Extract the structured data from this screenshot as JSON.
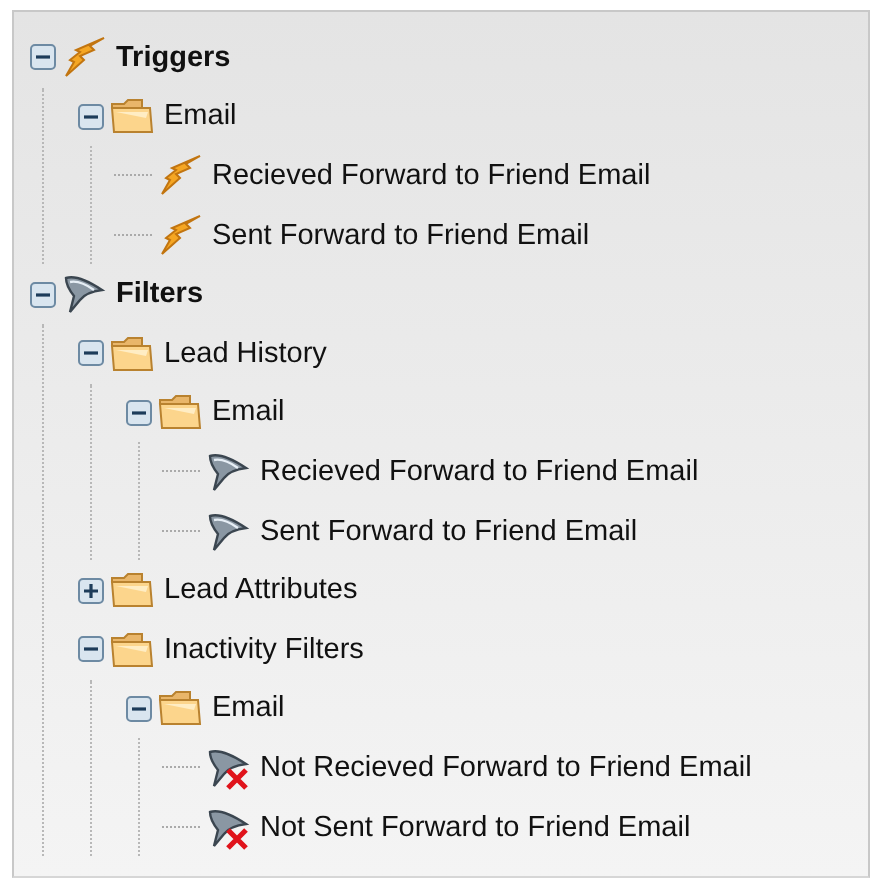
{
  "tree": [
    {
      "label": "Triggers",
      "kind": "trigger",
      "expanded": true,
      "children": [
        {
          "label": "Email",
          "kind": "folder",
          "expanded": true,
          "children": [
            {
              "label": "Recieved Forward to Friend Email",
              "kind": "trigger"
            },
            {
              "label": "Sent Forward to Friend Email",
              "kind": "trigger"
            }
          ]
        }
      ]
    },
    {
      "label": "Filters",
      "kind": "filter",
      "expanded": true,
      "children": [
        {
          "label": "Lead History",
          "kind": "folder",
          "expanded": true,
          "children": [
            {
              "label": "Email",
              "kind": "folder",
              "expanded": true,
              "children": [
                {
                  "label": "Recieved Forward to Friend Email",
                  "kind": "filter"
                },
                {
                  "label": "Sent Forward to Friend Email",
                  "kind": "filter"
                }
              ]
            }
          ]
        },
        {
          "label": "Lead Attributes",
          "kind": "folder",
          "expanded": false
        },
        {
          "label": "Inactivity Filters",
          "kind": "folder",
          "expanded": true,
          "children": [
            {
              "label": "Email",
              "kind": "folder",
              "expanded": true,
              "children": [
                {
                  "label": "Not Recieved Forward to Friend Email",
                  "kind": "negated-filter"
                },
                {
                  "label": "Not Sent Forward to Friend Email",
                  "kind": "negated-filter"
                }
              ]
            }
          ]
        }
      ]
    }
  ]
}
